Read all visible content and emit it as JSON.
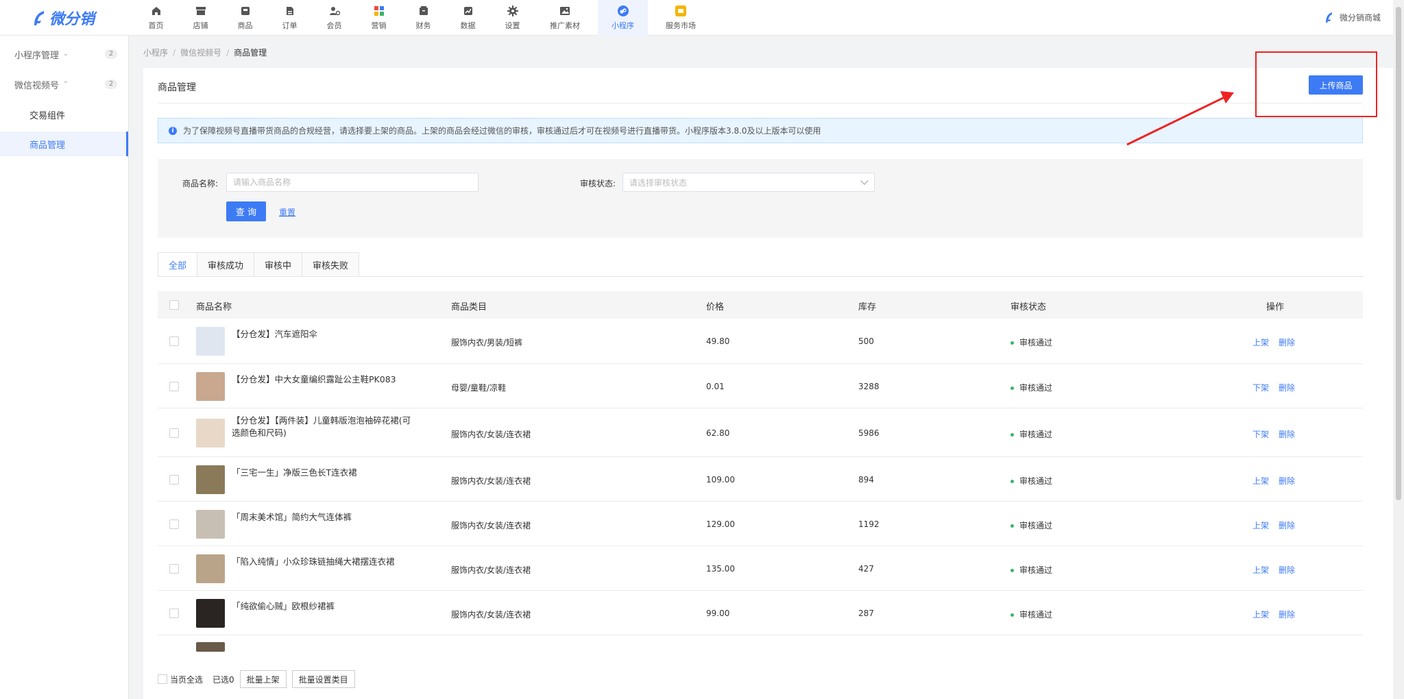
{
  "brand": {
    "name": "微分销",
    "accent": "#3d7bf5"
  },
  "nav": [
    {
      "label": "首页",
      "icon": "home-icon"
    },
    {
      "label": "店铺",
      "icon": "store-icon"
    },
    {
      "label": "商品",
      "icon": "goods-icon"
    },
    {
      "label": "订单",
      "icon": "order-icon"
    },
    {
      "label": "会员",
      "icon": "member-icon"
    },
    {
      "label": "营销",
      "icon": "marketing-icon"
    },
    {
      "label": "财务",
      "icon": "finance-icon"
    },
    {
      "label": "数据",
      "icon": "data-icon"
    },
    {
      "label": "设置",
      "icon": "gear-icon"
    },
    {
      "label": "推广素材",
      "icon": "image-icon"
    },
    {
      "label": "小程序",
      "icon": "link-icon",
      "active": true
    },
    {
      "label": "服务市场",
      "icon": "market-icon"
    }
  ],
  "top_right": {
    "shop_name": "微分销商城"
  },
  "sidebar": {
    "groups": [
      {
        "label": "小程序管理",
        "count": "2",
        "expanded": false
      },
      {
        "label": "微信视频号",
        "count": "2",
        "expanded": true
      }
    ],
    "subitems": [
      {
        "label": "交易组件"
      },
      {
        "label": "商品管理",
        "active": true
      }
    ]
  },
  "breadcrumb": [
    "小程序",
    "微信视频号",
    "商品管理"
  ],
  "page": {
    "title": "商品管理",
    "upload_label": "上传商品",
    "notice": "为了保障视频号直播带货商品的合规经营，请选择要上架的商品。上架的商品会经过微信的审核，审核通过后才可在视频号进行直播带货。小程序版本3.8.0及以上版本可以使用"
  },
  "filter": {
    "name_label": "商品名称:",
    "name_placeholder": "请输入商品名称",
    "status_label": "审核状态:",
    "status_placeholder": "请选择审核状态",
    "query_label": "查 询",
    "reset_label": "重置"
  },
  "tabs": [
    "全部",
    "审核成功",
    "审核中",
    "审核失败"
  ],
  "table": {
    "headers": [
      "商品名称",
      "商品类目",
      "价格",
      "库存",
      "审核状态",
      "操作"
    ],
    "rows": [
      {
        "name": "【分仓发】汽车遮阳伞",
        "category": "服饰内衣/男装/短裤",
        "price": "49.80",
        "stock": "500",
        "status": "审核通过",
        "action1": "上架",
        "action2": "删除"
      },
      {
        "name": "【分仓发】中大女童编织露趾公主鞋PK083",
        "category": "母婴/童鞋/凉鞋",
        "price": "0.01",
        "stock": "3288",
        "status": "审核通过",
        "action1": "下架",
        "action2": "删除"
      },
      {
        "name": "【分仓发】【两件装】儿童韩版泡泡袖碎花裙(可选颜色和尺码)",
        "category": "服饰内衣/女装/连衣裙",
        "price": "62.80",
        "stock": "5986",
        "status": "审核通过",
        "action1": "下架",
        "action2": "删除"
      },
      {
        "name": "「三宅一生」净版三色长T连衣裙",
        "category": "服饰内衣/女装/连衣裙",
        "price": "109.00",
        "stock": "894",
        "status": "审核通过",
        "action1": "上架",
        "action2": "删除"
      },
      {
        "name": "「周末美术馆」简约大气连体裤",
        "category": "服饰内衣/女装/连衣裙",
        "price": "129.00",
        "stock": "1192",
        "status": "审核通过",
        "action1": "上架",
        "action2": "删除"
      },
      {
        "name": "「陷入纯情」小众珍珠链抽绳大裙摆连衣裙",
        "category": "服饰内衣/女装/连衣裙",
        "price": "135.00",
        "stock": "427",
        "status": "审核通过",
        "action1": "上架",
        "action2": "删除"
      },
      {
        "name": "「纯欲偷心贼」欧根纱裙裤",
        "category": "服饰内衣/女装/连衣裙",
        "price": "99.00",
        "stock": "287",
        "status": "审核通过",
        "action1": "上架",
        "action2": "删除"
      }
    ]
  },
  "bottom_bar": {
    "select_all": "当页全选",
    "selected": "已选0",
    "batch_on": "批量上架",
    "batch_category": "批量设置类目"
  }
}
